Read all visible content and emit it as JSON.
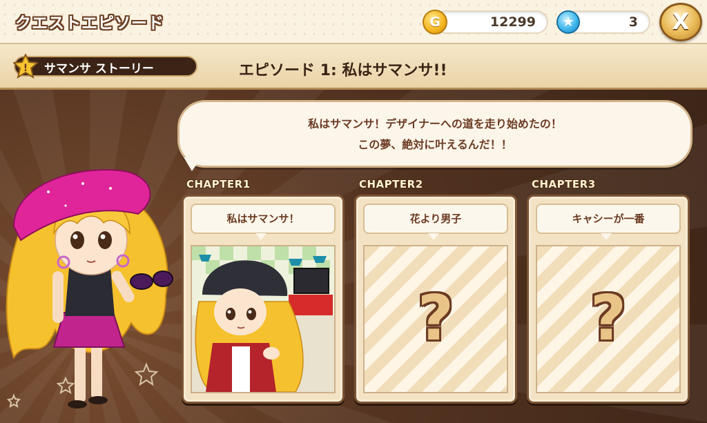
{
  "header": {
    "title": "クエストエピソード",
    "gold": "12299",
    "gold_icon": "G",
    "stars": "3",
    "close_label": "X"
  },
  "subheader": {
    "story_label": "サマンサ ストーリー",
    "episode_title": "エピソード 1: 私はサマンサ!!"
  },
  "dialog": {
    "line1": "私はサマンサ！デザイナーへの道を走り始めたの！",
    "line2": "この夢、絶対に叶えるんだ！！"
  },
  "chapters": [
    {
      "label": "CHAPTER1",
      "title": "私はサマンサ！",
      "locked": false
    },
    {
      "label": "CHAPTER2",
      "title": "花より男子",
      "locked": true
    },
    {
      "label": "CHAPTER3",
      "title": "キャシーが一番",
      "locked": true
    }
  ],
  "locked_symbol": "?",
  "colors": {
    "accent_gold": "#f4b41e",
    "accent_blue": "#38b3ea",
    "dark_brown": "#3b2416",
    "text_brown": "#6b3a22"
  }
}
